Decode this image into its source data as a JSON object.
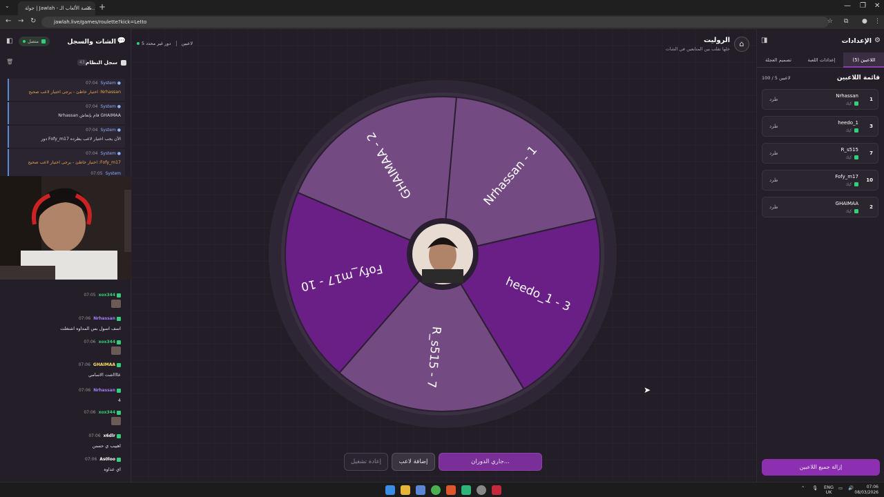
{
  "browser": {
    "tab_title": "جولة | Jawlah - منصة الألعاب الـ...",
    "url": "jawlah.live/games/roulette?kick=Letto"
  },
  "header": {
    "title": "الروليت",
    "subtitle": "خلها تقلب بين المتابعين في الشات",
    "players_count": "5 لاعبين",
    "turn_status": "دور غير محدد"
  },
  "wheel": {
    "segments": [
      {
        "label": "Nrhassan - 1",
        "color": "#744a82"
      },
      {
        "label": "heedo_1 - 3",
        "color": "#6a1f87"
      },
      {
        "label": "R_s515 - 7",
        "color": "#744a82"
      },
      {
        "label": "Fofy_m17 - 10",
        "color": "#6a1f87"
      },
      {
        "label": "GHAIMAA - 2",
        "color": "#744a82"
      }
    ]
  },
  "controls": {
    "spin_label": "جاري الدوران...",
    "add_label": "إضافة لاعب",
    "restart_label": "إعادة تشغيل"
  },
  "chat": {
    "title": "الشات والسجل",
    "connection": "متصل",
    "syslog_title": "سجل النظام",
    "syslog_count": "43",
    "system_entries": [
      {
        "time": "07:04",
        "user": "System",
        "text": "اختيار خاطئ - يرجى اختيار لاعب صحيح :Nrhassan",
        "tone": "orange"
      },
      {
        "time": "07:04",
        "user": "System",
        "text": "Nrhassan قام بإنعاش GHAIMAA",
        "tone": "white"
      },
      {
        "time": "07:04",
        "user": "System",
        "text": "دور Fofy_m17 الآن يجب اختيار لاعب يطرده",
        "tone": "white"
      },
      {
        "time": "07:04",
        "user": "System",
        "text": "اختيار خاطئ - يرجى اختيار لاعب صحيح :Fofy_m17",
        "tone": "orange"
      }
    ],
    "partial_time": "07:05",
    "messages": [
      {
        "time": "07:05",
        "user": "xox344",
        "color": "#31d17c",
        "text": "",
        "emote": true
      },
      {
        "time": "07:06",
        "user": "Nrhassan",
        "color": "#a77cff",
        "text": "اسف اسول بس المداوه اشتغلت",
        "emote": false
      },
      {
        "time": "07:06",
        "user": "xox344",
        "color": "#31d17c",
        "text": "",
        "emote": true
      },
      {
        "time": "07:06",
        "user": "GHAIMAA",
        "color": "#ffe36b",
        "text": "عااااشت الاسامي",
        "emote": false
      },
      {
        "time": "07:06",
        "user": "Nrhassan",
        "color": "#a77cff",
        "text": "4",
        "emote": false
      },
      {
        "time": "07:06",
        "user": "xox344",
        "color": "#31d17c",
        "text": "",
        "emote": true
      },
      {
        "time": "07:06",
        "user": "x6dlr",
        "color": "#ffffff",
        "text": "اهبيب ي حسنن",
        "emote": false
      },
      {
        "time": "07:06",
        "user": "As0loo",
        "color": "#ffffff",
        "text": "اي عداوه",
        "emote": false
      }
    ]
  },
  "settings": {
    "title": "الإعدادات",
    "tabs": [
      "اللاعبين (5)",
      "إعدادات اللعبة",
      "تصميم العجلة"
    ],
    "active_tab": 0,
    "list_title": "قائمة اللاعبين",
    "list_count": "100 / 5 لاعبين",
    "players": [
      {
        "num": "1",
        "name": "Nrhassan",
        "sub": "كيك",
        "kick": "طرد"
      },
      {
        "num": "3",
        "name": "heedo_1",
        "sub": "كيك",
        "kick": "طرد"
      },
      {
        "num": "7",
        "name": "R_s515",
        "sub": "كيك",
        "kick": "طرد"
      },
      {
        "num": "10",
        "name": "Fofy_m17",
        "sub": "كيك",
        "kick": "طرد"
      },
      {
        "num": "2",
        "name": "GHAIMAA",
        "sub": "كيك",
        "kick": "طرد"
      }
    ],
    "remove_all_label": "إزالة جميع اللاعبين"
  },
  "taskbar": {
    "lang": "ENG",
    "region": "UK",
    "time": "07:06",
    "date": "08/03/2026"
  }
}
